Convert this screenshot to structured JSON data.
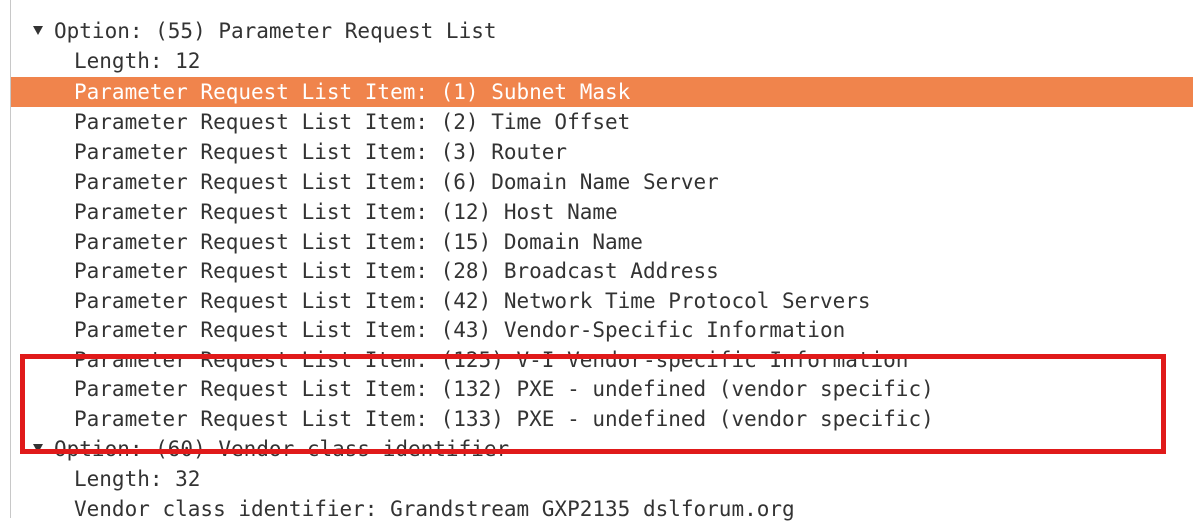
{
  "tree": {
    "rows": [
      {
        "text": "Option: (55) Parameter Request List"
      },
      {
        "text": "Length: 12"
      },
      {
        "text": "Parameter Request List Item: (1) Subnet Mask"
      },
      {
        "text": "Parameter Request List Item: (2) Time Offset"
      },
      {
        "text": "Parameter Request List Item: (3) Router"
      },
      {
        "text": "Parameter Request List Item: (6) Domain Name Server"
      },
      {
        "text": "Parameter Request List Item: (12) Host Name"
      },
      {
        "text": "Parameter Request List Item: (15) Domain Name"
      },
      {
        "text": "Parameter Request List Item: (28) Broadcast Address"
      },
      {
        "text": "Parameter Request List Item: (42) Network Time Protocol Servers"
      },
      {
        "text": "Parameter Request List Item: (43) Vendor-Specific Information"
      },
      {
        "text": "Parameter Request List Item: (125) V-I Vendor-specific Information"
      },
      {
        "text": "Parameter Request List Item: (132) PXE - undefined (vendor specific)"
      },
      {
        "text": "Parameter Request List Item: (133) PXE - undefined (vendor specific)"
      },
      {
        "text": "Option: (60) Vendor class identifier"
      },
      {
        "text": "Length: 32"
      },
      {
        "text": "Vendor class identifier: Grandstream GXP2135 dslforum.org"
      }
    ]
  },
  "selected_row_color": "#f0844c",
  "annotation_color": "#e01a1a",
  "icons": {
    "expand_arrow": "triangle-down-icon"
  }
}
